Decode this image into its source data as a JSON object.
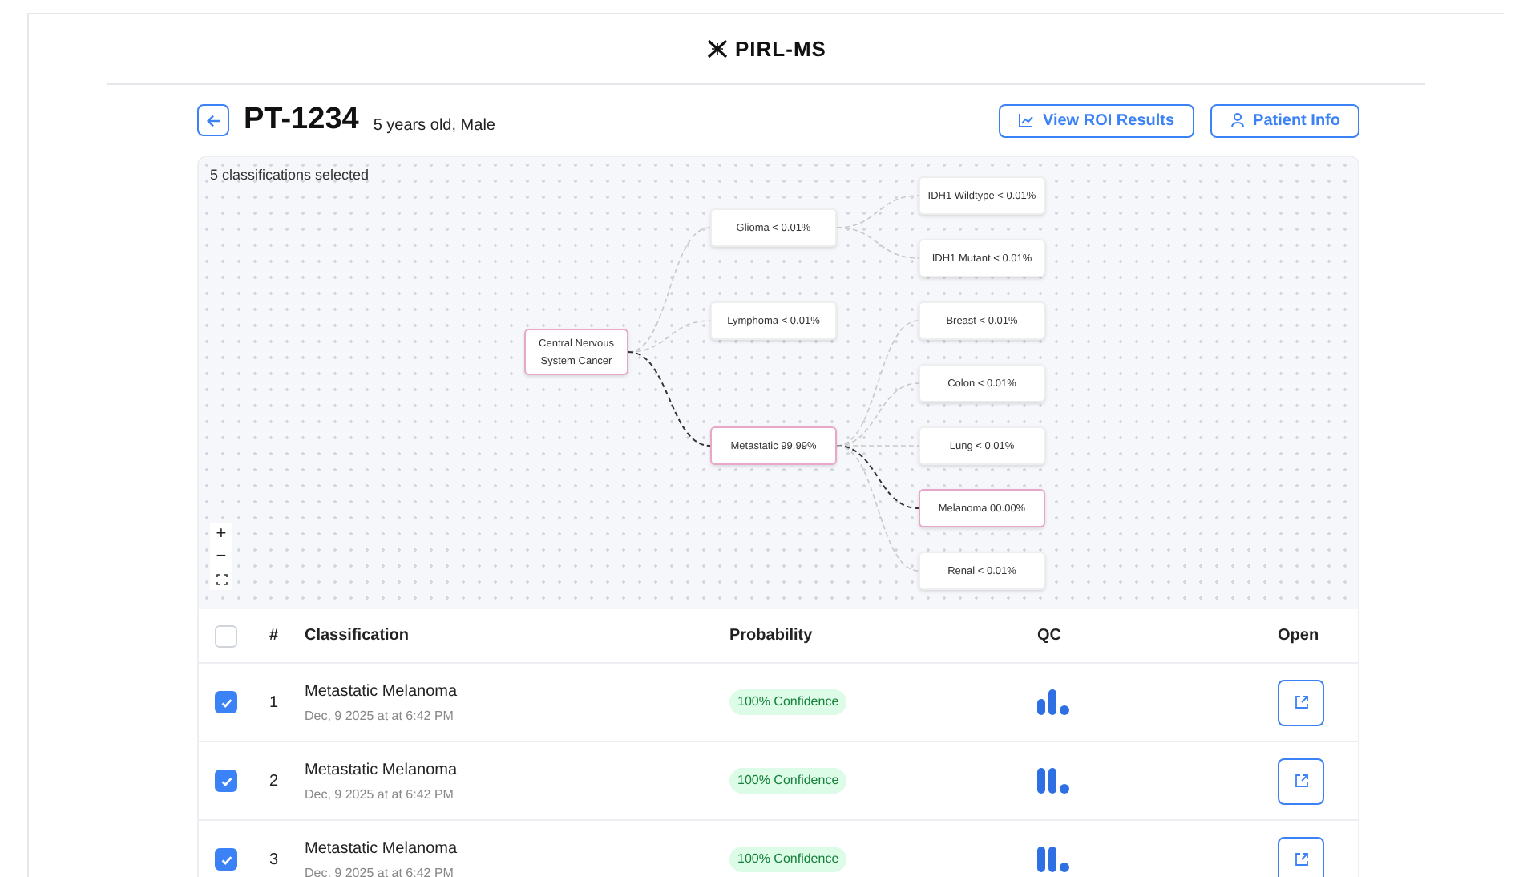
{
  "brand": "PIRL-MS",
  "patient": {
    "id": "PT-1234",
    "details": "5 years old, Male"
  },
  "actions": [
    {
      "kind": "chart",
      "label": "View ROI Results"
    },
    {
      "kind": "person",
      "label": "Patient Info"
    }
  ],
  "tree": {
    "caption": "5 classifications selected",
    "root": {
      "label": "Central Nervous System Cancer",
      "selected": true,
      "children": [
        {
          "label": "Glioma < 0.01%",
          "selected": false,
          "children": [
            {
              "label": "IDH1 Wildtype < 0.01%",
              "selected": false
            },
            {
              "label": "IDH1 Mutant < 0.01%",
              "selected": false
            }
          ]
        },
        {
          "label": "Lymphoma < 0.01%",
          "selected": false
        },
        {
          "label": "Metastatic 99.99%",
          "selected": true,
          "children": [
            {
              "label": "Breast < 0.01%",
              "selected": false
            },
            {
              "label": "Colon < 0.01%",
              "selected": false
            },
            {
              "label": "Lung < 0.01%",
              "selected": false
            },
            {
              "label": "Melanoma 00.00%",
              "selected": true
            },
            {
              "label": "Renal < 0.01%",
              "selected": false
            }
          ]
        }
      ]
    },
    "controls": [
      {
        "kind": "zoom-in",
        "label": "+"
      },
      {
        "kind": "zoom-out",
        "label": "−"
      },
      {
        "kind": "fit"
      }
    ]
  },
  "table": {
    "select_all": {
      "checked": false
    },
    "columns": [
      "#",
      "Classification",
      "Probability",
      "QC",
      "Open"
    ],
    "rows": [
      {
        "checked": true,
        "number": "1",
        "title": "Metastatic Melanoma",
        "date": "Dec, 9 2025 at at 6:42 PM",
        "probability": "100% Confidence",
        "kind": "medium"
      },
      {
        "checked": true,
        "number": "2",
        "title": "Metastatic Melanoma",
        "date": "Dec, 9 2025 at at 6:42 PM",
        "probability": "100% Confidence",
        "kind": "high"
      },
      {
        "checked": true,
        "number": "3",
        "title": "Metastatic Melanoma",
        "date": "Dec, 9 2025 at at 6:42 PM",
        "probability": "100% Confidence",
        "kind": "high"
      }
    ]
  }
}
